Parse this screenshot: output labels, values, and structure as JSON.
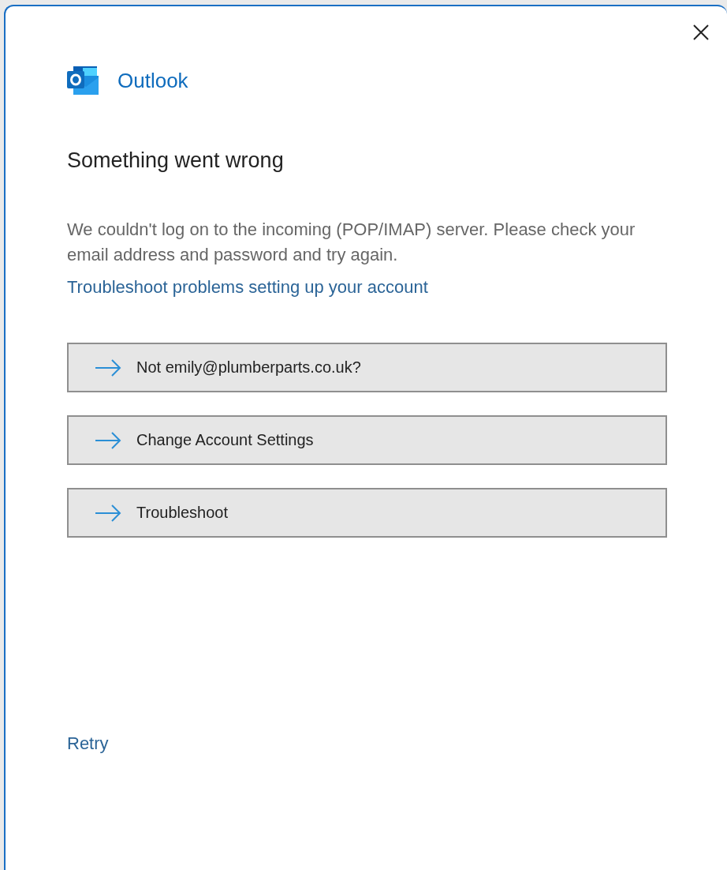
{
  "window": {
    "app_name": "Outlook"
  },
  "heading": "Something went wrong",
  "message": "We couldn't log on to the incoming (POP/IMAP) server. Please check your email address and password and try again.",
  "help_link": "Troubleshoot problems setting up your account",
  "actions": [
    {
      "label": "Not emily@plumberparts.co.uk?"
    },
    {
      "label": "Change Account Settings"
    },
    {
      "label": "Troubleshoot"
    }
  ],
  "footer_link": "Retry"
}
